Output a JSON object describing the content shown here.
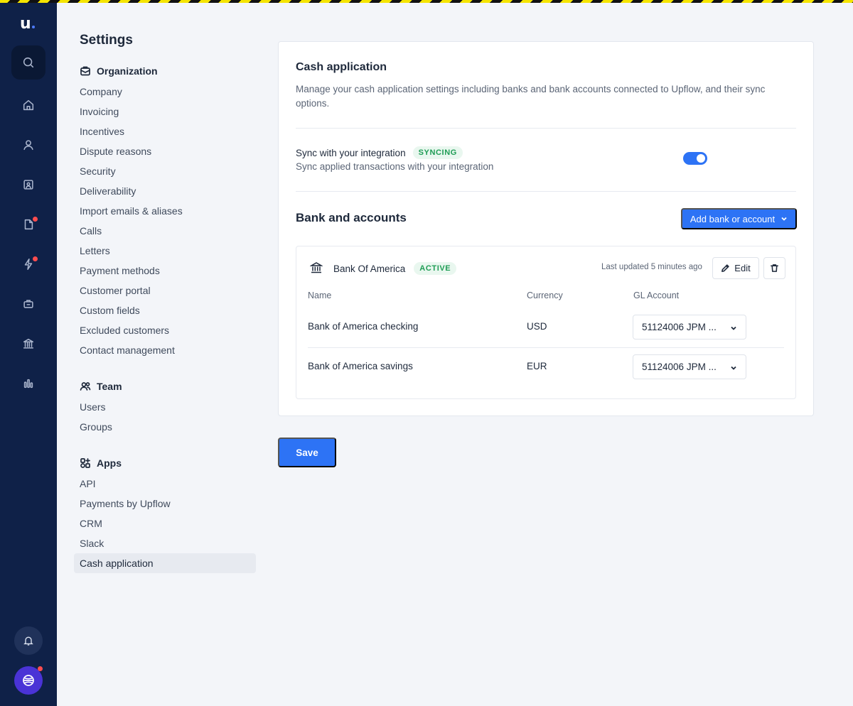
{
  "app": {
    "logo_text": "u"
  },
  "rail": {
    "icons": [
      "search-icon",
      "home-icon",
      "user-icon",
      "contact-card-icon",
      "document-icon",
      "lightning-icon",
      "briefcase-icon",
      "bank-icon",
      "bar-chart-icon",
      "bell-icon",
      "globe-icon"
    ],
    "notification_color": "#ff4d4f",
    "background": "#0f2148"
  },
  "settings": {
    "title": "Settings",
    "organization": {
      "label": "Organization",
      "items": [
        "Company",
        "Invoicing",
        "Incentives",
        "Dispute reasons",
        "Security",
        "Deliverability",
        "Import emails & aliases",
        "Calls",
        "Letters",
        "Payment methods",
        "Customer portal",
        "Custom fields",
        "Excluded customers",
        "Contact management"
      ]
    },
    "team": {
      "label": "Team",
      "items": [
        "Users",
        "Groups"
      ]
    },
    "apps": {
      "label": "Apps",
      "items": [
        "API",
        "Payments by Upflow",
        "CRM",
        "Slack",
        "Cash application"
      ],
      "active": "Cash application"
    }
  },
  "card": {
    "title": "Cash application",
    "description": "Manage your cash application settings including banks and bank accounts connected to Upflow, and their sync options.",
    "sync": {
      "title": "Sync with your integration",
      "badge": "SYNCING",
      "subtitle": "Sync applied transactions with your integration",
      "enabled": true
    },
    "banks": {
      "heading": "Bank and accounts",
      "add_button": "Add bank or account",
      "bank": {
        "name": "Bank Of America",
        "status": "ACTIVE",
        "updated": "Last updated 5 minutes ago",
        "edit_label": "Edit",
        "columns": [
          "Name",
          "Currency",
          "GL Account"
        ],
        "accounts": [
          {
            "name": "Bank of America checking",
            "currency": "USD",
            "gl_account": "51124006 JPM ..."
          },
          {
            "name": "Bank of America savings",
            "currency": "EUR",
            "gl_account": "51124006 JPM ..."
          }
        ]
      }
    }
  },
  "save_label": "Save",
  "colors": {
    "accent": "#2d73f5",
    "success": "#1f9d55"
  }
}
